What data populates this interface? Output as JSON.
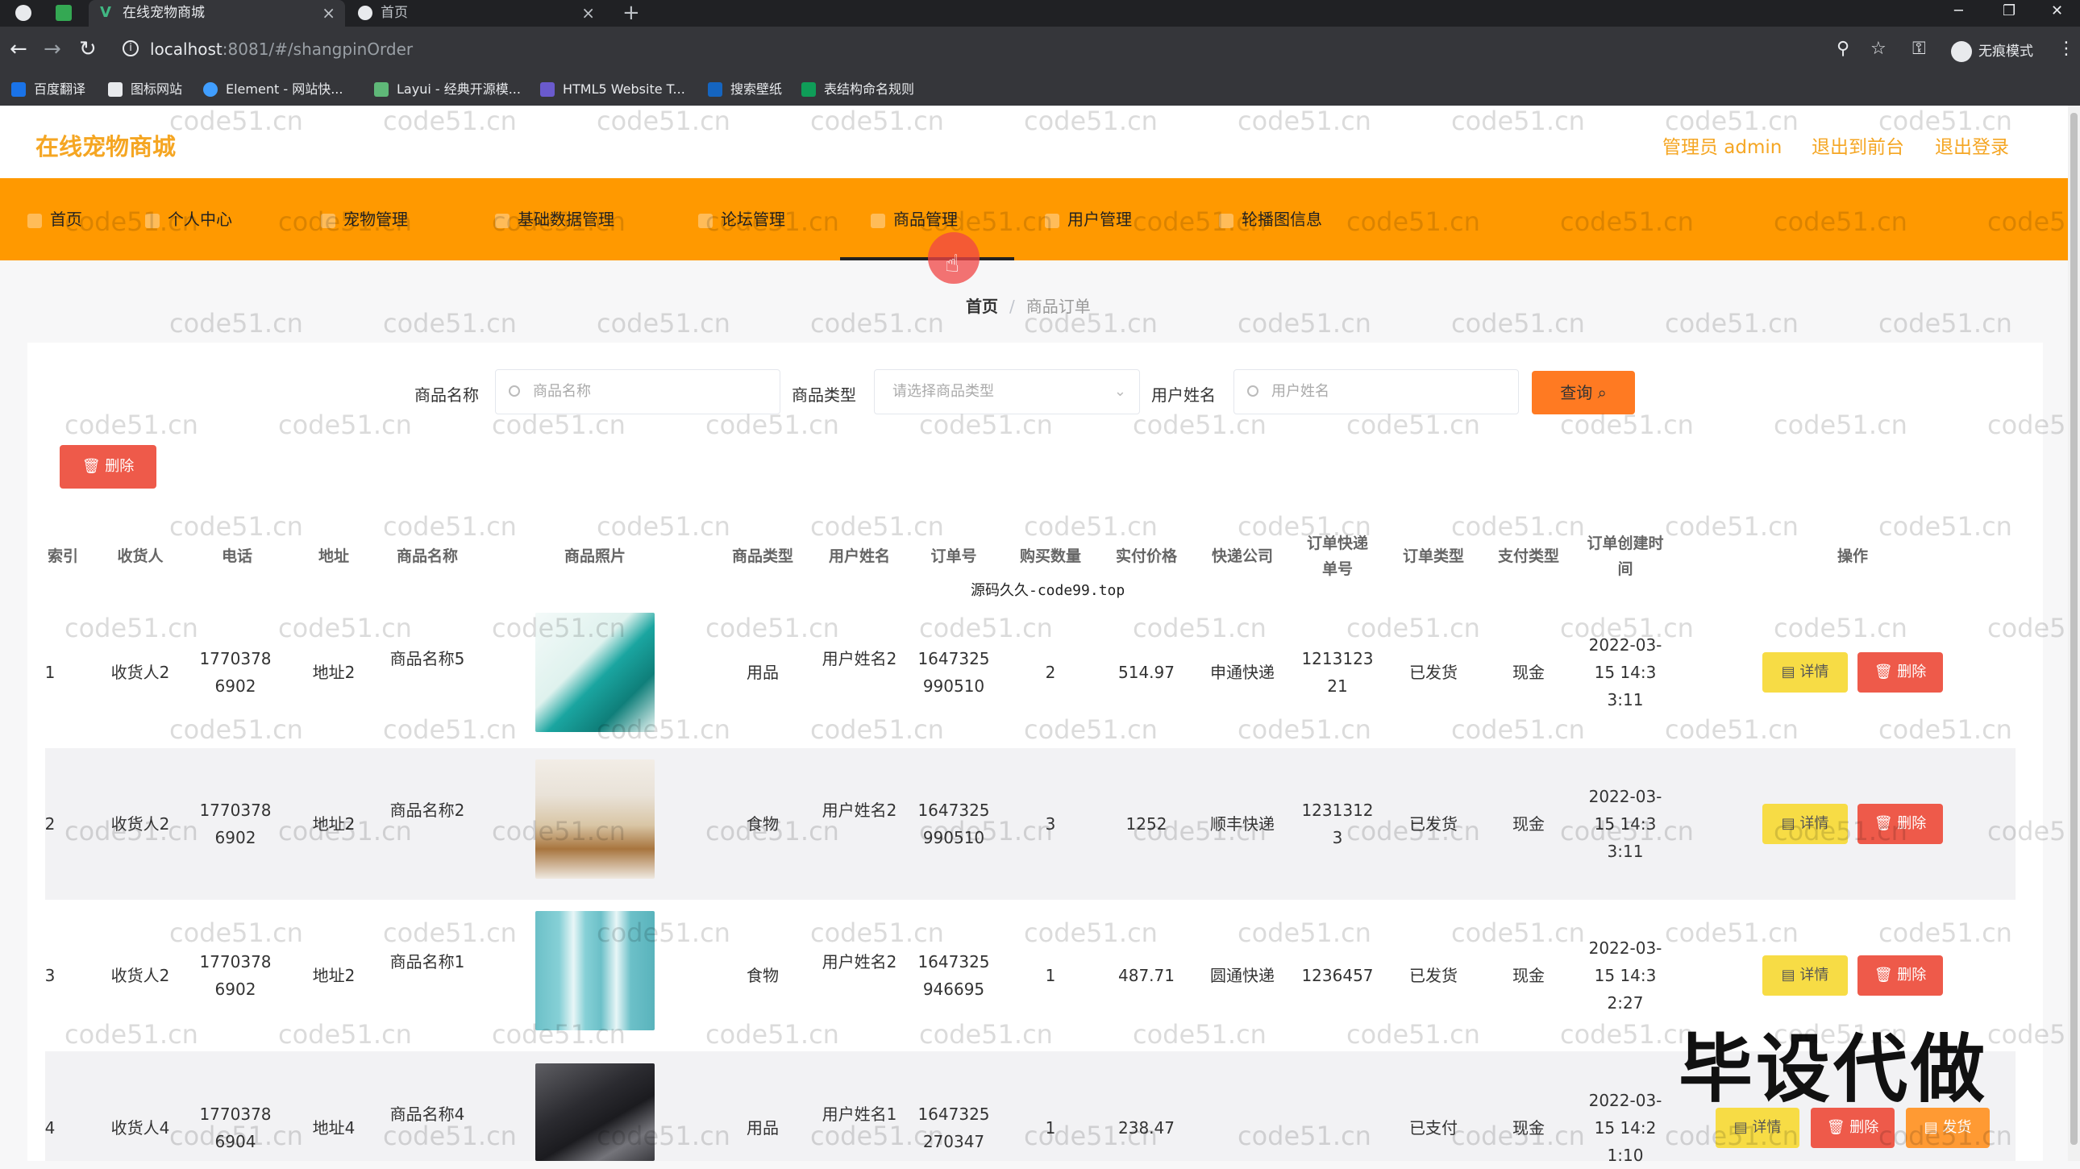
{
  "browser": {
    "tabs": [
      {
        "title": "在线宠物商城",
        "active": true
      },
      {
        "title": "首页",
        "active": false
      }
    ],
    "url_host": "localhost",
    "url_path": ":8081/#/shangpinOrder",
    "profile": "无痕模式",
    "bookmarks": [
      "百度翻译",
      "图标网站",
      "Element - 网站快...",
      "Layui - 经典开源模...",
      "HTML5 Website T...",
      "搜索壁纸",
      "表结构命名规则"
    ]
  },
  "header": {
    "brand": "在线宠物商城",
    "admin": "管理员 admin",
    "to_front": "退出到前台",
    "logout": "退出登录"
  },
  "nav": [
    "首页",
    "个人中心",
    "宠物管理",
    "基础数据管理",
    "论坛管理",
    "商品管理",
    "用户管理",
    "轮播图信息"
  ],
  "breadcrumb": {
    "home": "首页",
    "current": "商品订单"
  },
  "search": {
    "name_label": "商品名称",
    "name_placeholder": "商品名称",
    "type_label": "商品类型",
    "type_placeholder": "请选择商品类型",
    "user_label": "用户姓名",
    "user_placeholder": "用户姓名",
    "query_label": "查询"
  },
  "toolbar": {
    "delete_label": "删除"
  },
  "columns": [
    "索引",
    "收货人",
    "电话",
    "地址",
    "商品名称",
    "商品照片",
    "商品类型",
    "用户姓名",
    "订单号",
    "购买数量",
    "实付价格",
    "快递公司",
    "订单快递单号",
    "订单类型",
    "支付类型",
    "订单创建时间",
    "操作"
  ],
  "rows": [
    {
      "index": "1",
      "receiver": "收货人2",
      "phone": "17703786902",
      "address": "地址2",
      "product": "商品名称5",
      "photo": "teal-cosmetics",
      "type": "用品",
      "user": "用户姓名2",
      "order_no": "1647325990510",
      "qty": "2",
      "price": "514.97",
      "courier": "申通快递",
      "tracking": "121312321",
      "status": "已发货",
      "pay": "现金",
      "created": "2022-03-15 14:33:11",
      "actions": [
        "详情",
        "删除"
      ]
    },
    {
      "index": "2",
      "receiver": "收货人2",
      "phone": "17703786902",
      "address": "地址2",
      "product": "商品名称2",
      "photo": "fashion-model",
      "type": "食物",
      "user": "用户姓名2",
      "order_no": "1647325990510",
      "qty": "3",
      "price": "1252",
      "courier": "顺丰快递",
      "tracking": "12313123",
      "status": "已发货",
      "pay": "现金",
      "created": "2022-03-15 14:33:11",
      "actions": [
        "详情",
        "删除"
      ]
    },
    {
      "index": "3",
      "receiver": "收货人2",
      "phone": "17703786902",
      "address": "地址2",
      "product": "商品名称1",
      "photo": "blue-bottles",
      "type": "食物",
      "user": "用户姓名2",
      "order_no": "1647325946695",
      "qty": "1",
      "price": "487.71",
      "courier": "圆通快递",
      "tracking": "1236457",
      "status": "已发货",
      "pay": "现金",
      "created": "2022-03-15 14:32:27",
      "actions": [
        "详情",
        "删除"
      ]
    },
    {
      "index": "4",
      "receiver": "收货人4",
      "phone": "17703786904",
      "address": "地址4",
      "product": "商品名称4",
      "photo": "laptop",
      "type": "用品",
      "user": "用户姓名1",
      "order_no": "1647325270347",
      "qty": "1",
      "price": "238.47",
      "courier": "",
      "tracking": "",
      "status": "已支付",
      "pay": "现金",
      "created": "2022-03-15 14:21:10",
      "actions": [
        "详情",
        "删除",
        "发货"
      ]
    }
  ],
  "overlay": {
    "source_note": "源码久久-code99.top",
    "promo": "毕设代做",
    "watermark": "code51.cn"
  },
  "colors": {
    "accent": "#ff9900",
    "brand_text": "#f5a623",
    "query": "#ff7a22",
    "danger": "#ee5a4a",
    "detail": "#f7dc45"
  }
}
